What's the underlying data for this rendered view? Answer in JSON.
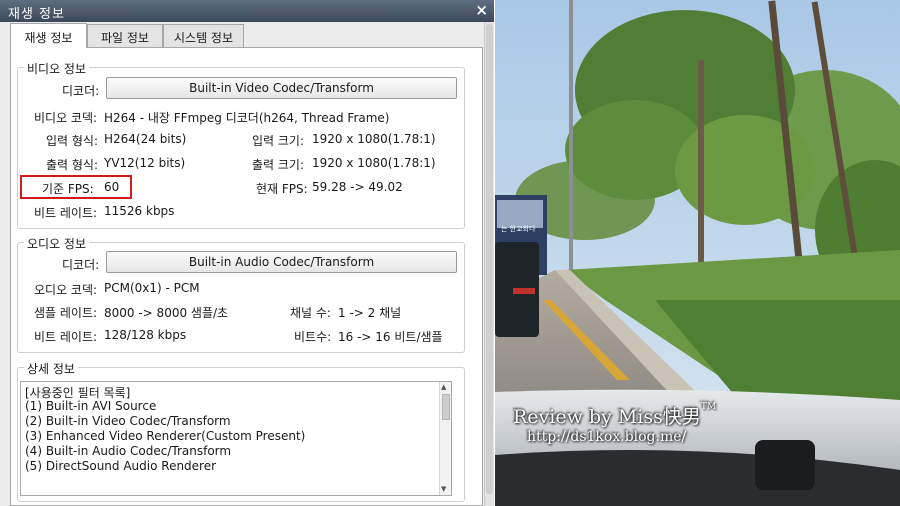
{
  "window": {
    "title": "재생 정보",
    "close_symbol": "×"
  },
  "tabs": [
    {
      "label": "재생 정보"
    },
    {
      "label": "파일 정보"
    },
    {
      "label": "시스템 정보"
    }
  ],
  "video": {
    "section": "비디오 정보",
    "decoder_label": "디코더:",
    "decoder_button": "Built-in Video Codec/Transform",
    "codec_label": "비디오 코덱:",
    "codec_value": "H264 - 내장 FFmpeg 디코더(h264, Thread Frame)",
    "input_format_label": "입력 형식:",
    "input_format_value": "H264(24 bits)",
    "input_size_label": "입력 크기:",
    "input_size_value": "1920 x 1080(1.78:1)",
    "output_format_label": "출력 형식:",
    "output_format_value": "YV12(12 bits)",
    "output_size_label": "출력 크기:",
    "output_size_value": "1920 x 1080(1.78:1)",
    "base_fps_label": "기준 FPS:",
    "base_fps_value": "60",
    "current_fps_label": "현재 FPS:",
    "current_fps_value": "59.28 -> 49.02",
    "bitrate_label": "비트 레이트:",
    "bitrate_value": "11526 kbps"
  },
  "audio": {
    "section": "오디오 정보",
    "decoder_label": "디코더:",
    "decoder_button": "Built-in Audio Codec/Transform",
    "codec_label": "오디오 코덱:",
    "codec_value": "PCM(0x1) - PCM",
    "sample_rate_label": "샘플 레이트:",
    "sample_rate_value": "8000 -> 8000 샘플/초",
    "channels_label": "채널 수:",
    "channels_value": "1 -> 2 채널",
    "bitrate_label": "비트 레이트:",
    "bitrate_value": "128/128 kbps",
    "bits_label": "비트수:",
    "bits_value": "16 -> 16 비트/샘플"
  },
  "details": {
    "section": "상세 정보",
    "lines": [
      "[사용중인 필터 목록]",
      "(1) Built-in AVI Source",
      "(2) Built-in Video Codec/Transform",
      "(3) Enhanced Video Renderer(Custom Present)",
      "(4) Built-in Audio Codec/Transform",
      "(5) DirectSound Audio Renderer"
    ]
  },
  "photo": {
    "watermark_prefix": "Review by ",
    "watermark_name": "Miss快男",
    "watermark_tm": "TM",
    "watermark_url": "http://ds1kox.blog.me/",
    "bus_sign": "는 한교회다"
  },
  "colors": {
    "highlight_box": "#d11a1a",
    "titlebar": "#4a586b"
  }
}
